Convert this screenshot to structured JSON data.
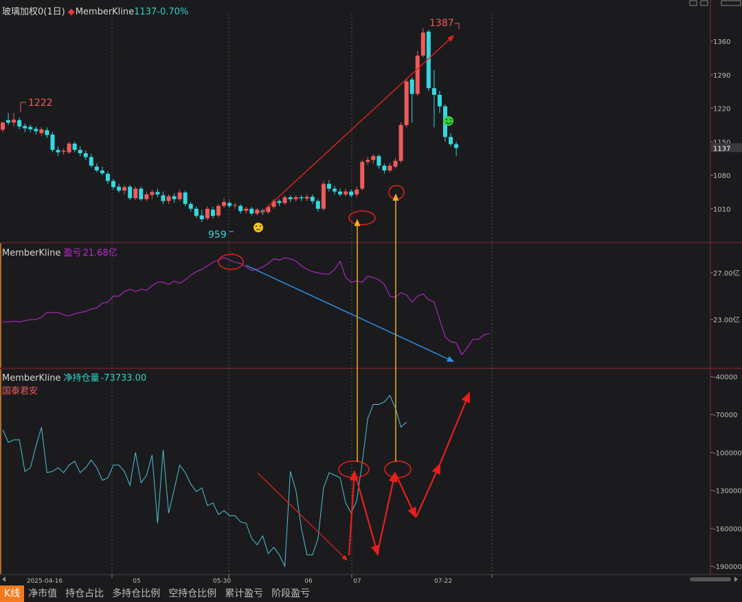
{
  "headers": {
    "p1_title": "玻璃加权0(1日)",
    "p1_diamond": "◆",
    "p1_indicator": "MemberKline",
    "p1_value": "1137",
    "p1_change": "-0.70%",
    "p2_indicator": "MemberKline",
    "p2_label": "盈亏",
    "p2_value": "21.68亿",
    "p3_indicator": "MemberKline",
    "p3_label": "净持仓量",
    "p3_value": "-73733.00",
    "p3_member": "国泰君安"
  },
  "tabs": [
    "K线",
    "净市值",
    "持仓占比",
    "多持仓比例",
    "空持仓比例",
    "累计盈亏",
    "阶段盈亏"
  ],
  "colors": {
    "up": "#f05a5a",
    "down": "#33d9e0",
    "pnl_line": "#c22bd6",
    "netpos_line": "#4fc3d3",
    "arrow_red": "#e8201c",
    "arrow_blue": "#2f8fe0",
    "arrow_gold": "#f2b01e",
    "member_label": "#e85a5a"
  },
  "chart_data": [
    {
      "type": "candlestick",
      "title": "玻璃加权0(1日)",
      "yticks": [
        1010,
        1080,
        1150,
        1220,
        1290,
        1360
      ],
      "current_price_label": "1137",
      "annotations": [
        {
          "text": "1222",
          "value": 1222
        },
        {
          "text": "959",
          "value": 959
        },
        {
          "text": "1387",
          "value": 1387
        }
      ],
      "x_labels": [
        "2025-04-16",
        "05",
        "05-30",
        "06",
        "07",
        "07-22"
      ],
      "candles": [
        [
          1175,
          1190,
          1170,
          1192
        ],
        [
          1195,
          1190,
          1185,
          1210
        ],
        [
          1190,
          1196,
          1182,
          1210
        ],
        [
          1195,
          1182,
          1176,
          1200
        ],
        [
          1183,
          1178,
          1170,
          1188
        ],
        [
          1181,
          1176,
          1170,
          1186
        ],
        [
          1177,
          1172,
          1165,
          1182
        ],
        [
          1168,
          1176,
          1162,
          1181
        ],
        [
          1174,
          1164,
          1158,
          1180
        ],
        [
          1165,
          1133,
          1128,
          1170
        ],
        [
          1133,
          1128,
          1120,
          1140
        ],
        [
          1129,
          1131,
          1123,
          1136
        ],
        [
          1128,
          1146,
          1125,
          1150
        ],
        [
          1146,
          1133,
          1128,
          1150
        ],
        [
          1133,
          1126,
          1120,
          1140
        ],
        [
          1126,
          1118,
          1112,
          1132
        ],
        [
          1118,
          1100,
          1096,
          1125
        ],
        [
          1098,
          1090,
          1086,
          1105
        ],
        [
          1090,
          1084,
          1080,
          1098
        ],
        [
          1083,
          1068,
          1062,
          1088
        ],
        [
          1068,
          1055,
          1050,
          1072
        ],
        [
          1056,
          1048,
          1044,
          1062
        ],
        [
          1048,
          1055,
          1040,
          1060
        ],
        [
          1056,
          1032,
          1028,
          1060
        ],
        [
          1032,
          1052,
          1028,
          1056
        ],
        [
          1052,
          1030,
          1026,
          1056
        ],
        [
          1030,
          1040,
          1026,
          1046
        ],
        [
          1039,
          1045,
          1030,
          1050
        ],
        [
          1045,
          1040,
          1034,
          1052
        ],
        [
          1038,
          1026,
          1020,
          1046
        ],
        [
          1026,
          1036,
          1020,
          1040
        ],
        [
          1036,
          1030,
          1022,
          1042
        ],
        [
          1030,
          1044,
          1026,
          1050
        ],
        [
          1044,
          1020,
          1015,
          1048
        ],
        [
          1020,
          1010,
          1004,
          1024
        ],
        [
          1010,
          995,
          991,
          1015
        ],
        [
          996,
          988,
          982,
          1008
        ],
        [
          990,
          1010,
          986,
          1015
        ],
        [
          1008,
          995,
          990,
          1014
        ],
        [
          996,
          1016,
          992,
          1020
        ],
        [
          1016,
          1024,
          1012,
          1032
        ],
        [
          1022,
          1016,
          1012,
          1026
        ],
        [
          1017,
          1018,
          1010,
          1022
        ],
        [
          1016,
          1005,
          1000,
          1020
        ],
        [
          1006,
          1010,
          1000,
          1014
        ],
        [
          1010,
          1000,
          996,
          1014
        ],
        [
          1000,
          1008,
          996,
          1012
        ],
        [
          1006,
          1003,
          997,
          1010
        ],
        [
          1003,
          1014,
          999,
          1018
        ],
        [
          1014,
          1026,
          1010,
          1030
        ],
        [
          1026,
          1022,
          1016,
          1030
        ],
        [
          1022,
          1034,
          1018,
          1038
        ],
        [
          1034,
          1030,
          1024,
          1038
        ],
        [
          1030,
          1034,
          1025,
          1038
        ],
        [
          1034,
          1032,
          1026,
          1038
        ],
        [
          1031,
          1035,
          1026,
          1040
        ],
        [
          1035,
          1026,
          1020,
          1040
        ],
        [
          1026,
          1010,
          1004,
          1030
        ],
        [
          1010,
          1062,
          1006,
          1068
        ],
        [
          1062,
          1052,
          1046,
          1070
        ],
        [
          1052,
          1046,
          1040,
          1058
        ],
        [
          1046,
          1040,
          1036,
          1052
        ],
        [
          1040,
          1046,
          1036,
          1052
        ],
        [
          1046,
          1038,
          1034,
          1050
        ],
        [
          1040,
          1050,
          1034,
          1056
        ],
        [
          1052,
          1108,
          1048,
          1112
        ],
        [
          1108,
          1112,
          1102,
          1118
        ],
        [
          1112,
          1120,
          1104,
          1124
        ],
        [
          1120,
          1100,
          1094,
          1124
        ],
        [
          1100,
          1090,
          1084,
          1104
        ],
        [
          1090,
          1100,
          1086,
          1106
        ],
        [
          1098,
          1110,
          1094,
          1116
        ],
        [
          1110,
          1185,
          1106,
          1190
        ],
        [
          1185,
          1276,
          1180,
          1282
        ],
        [
          1280,
          1250,
          1190,
          1285
        ],
        [
          1250,
          1330,
          1246,
          1340
        ],
        [
          1330,
          1378,
          1326,
          1387
        ],
        [
          1380,
          1262,
          1256,
          1384
        ],
        [
          1262,
          1248,
          1180,
          1300
        ],
        [
          1248,
          1224,
          1210,
          1256
        ],
        [
          1224,
          1160,
          1150,
          1228
        ],
        [
          1160,
          1145,
          1140,
          1168
        ],
        [
          1145,
          1137,
          1120,
          1150
        ]
      ]
    },
    {
      "type": "line",
      "title": "盈亏",
      "series": [
        {
          "name": "盈亏",
          "values": [
            22.8,
            22.8,
            22.85,
            22.8,
            22.9,
            23.0,
            23.0,
            23.2,
            23.6,
            23.6,
            23.6,
            23.4,
            23.3,
            23.5,
            23.6,
            23.7,
            23.9,
            24.0,
            24.4,
            24.5,
            25.0,
            25.0,
            25.4,
            25.6,
            25.4,
            25.6,
            25.5,
            25.9,
            26.2,
            26.2,
            26.0,
            26.3,
            26.1,
            26.4,
            26.8,
            27.1,
            27.3,
            27.6,
            27.9,
            28.1,
            28.3,
            28.1,
            27.9,
            27.8,
            27.5,
            27.2,
            27.3,
            27.5,
            27.8,
            28.2,
            28.1,
            28.3,
            28.2,
            28.0,
            27.6,
            27.3,
            27.1,
            27.0,
            26.9,
            26.9,
            27.3,
            28.0,
            26.6,
            26.2,
            26.3,
            26.2,
            26.7,
            26.6,
            26.4,
            26.0,
            25.0,
            24.9,
            25.3,
            25.1,
            24.5,
            25.0,
            25.2,
            24.7,
            24.5,
            23.0,
            21.5,
            21.1,
            21.0,
            20.0,
            20.6,
            21.3,
            21.3,
            21.7,
            21.8
          ]
        }
      ],
      "yticks": [
        "27.00亿",
        "23.00亿"
      ],
      "ytick_values": [
        27.0,
        23.0
      ]
    },
    {
      "type": "line",
      "title": "净持仓量",
      "series": [
        {
          "name": "净持仓量",
          "values": [
            -82000,
            -92000,
            -90000,
            -90000,
            -115000,
            -112000,
            -95000,
            -80000,
            -116000,
            -115000,
            -112000,
            -116000,
            -110000,
            -107000,
            -116000,
            -112000,
            -106000,
            -112000,
            -122000,
            -120000,
            -110000,
            -110000,
            -115000,
            -126000,
            -100000,
            -124000,
            -118000,
            -102000,
            -156000,
            -98000,
            -148000,
            -129000,
            -110000,
            -116000,
            -125000,
            -131000,
            -128000,
            -142000,
            -140000,
            -149000,
            -146000,
            -150000,
            -150000,
            -155000,
            -156000,
            -168000,
            -173000,
            -166000,
            -180000,
            -175000,
            -181000,
            -190000,
            -115000,
            -130000,
            -160000,
            -181000,
            -181000,
            -168000,
            -128000,
            -116000,
            -118000,
            -120000,
            -140000,
            -148000,
            -138000,
            -108000,
            -73000,
            -62000,
            -62000,
            -60000,
            -55000,
            -65000,
            -80000,
            -76000
          ]
        }
      ],
      "yticks": [
        "-40000",
        "-70000",
        "-100000",
        "-130000",
        "-160000",
        "-190000"
      ],
      "ytick_values": [
        -40000,
        -70000,
        -100000,
        -130000,
        -160000,
        -190000
      ]
    }
  ]
}
